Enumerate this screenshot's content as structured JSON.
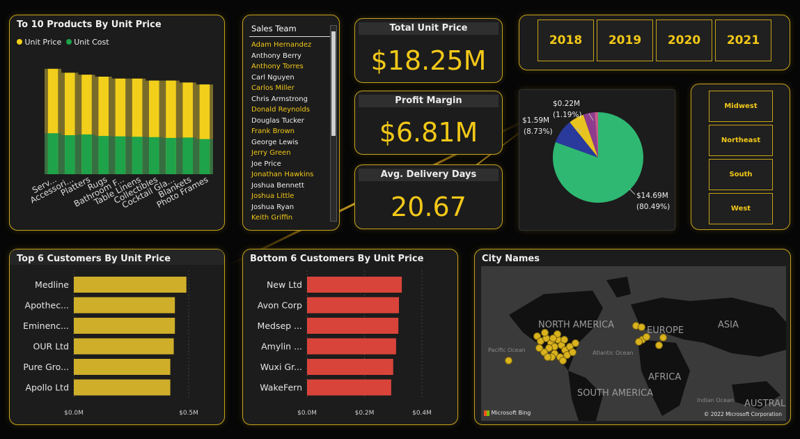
{
  "colors": {
    "accent_gold": "#f2c818",
    "unit_price": "#f2cf1a",
    "unit_cost": "#1fa34a",
    "customer_bar": "#cfae2a",
    "bottom_bar": "#d9443a",
    "pie_green": "#2eb872",
    "pie_navy": "#2a3a9c",
    "pie_yellow": "#e8c420",
    "pie_purple": "#8e3c8e"
  },
  "top_products": {
    "title": "To 10 Products By Unit Price",
    "legend": [
      {
        "label": "Unit Price",
        "color": "#f2cf1a"
      },
      {
        "label": "Unit Cost",
        "color": "#1fa34a"
      }
    ],
    "x_labels": [
      "Serv...",
      "Accessori...",
      "Platters",
      "Rugs",
      "Bathroom F...",
      "Table Linens",
      "Collectibles",
      "Cocktail Gla...",
      "Blankets",
      "Photo Frames"
    ]
  },
  "sales_team": {
    "header": "Sales Team",
    "items": [
      {
        "name": "Adam Hernandez",
        "selected": true
      },
      {
        "name": "Anthony Berry",
        "selected": false
      },
      {
        "name": "Anthony Torres",
        "selected": true
      },
      {
        "name": "Carl Nguyen",
        "selected": false
      },
      {
        "name": "Carlos Miller",
        "selected": true
      },
      {
        "name": "Chris Armstrong",
        "selected": false
      },
      {
        "name": "Donald Reynolds",
        "selected": true
      },
      {
        "name": "Douglas Tucker",
        "selected": false
      },
      {
        "name": "Frank Brown",
        "selected": true
      },
      {
        "name": "George Lewis",
        "selected": false
      },
      {
        "name": "Jerry Green",
        "selected": true
      },
      {
        "name": "Joe Price",
        "selected": false
      },
      {
        "name": "Jonathan Hawkins",
        "selected": true
      },
      {
        "name": "Joshua Bennett",
        "selected": false
      },
      {
        "name": "Joshua Little",
        "selected": true
      },
      {
        "name": "Joshua Ryan",
        "selected": false
      },
      {
        "name": "Keith Griffin",
        "selected": true
      }
    ]
  },
  "kpis": {
    "total_unit_price": {
      "label": "Total Unit Price",
      "value": "$18.25M"
    },
    "profit_margin": {
      "label": "Profit Margin",
      "value": "$6.81M"
    },
    "avg_delivery": {
      "label": "Avg. Delivery Days",
      "value": "20.67"
    }
  },
  "years": [
    "2018",
    "2019",
    "2020",
    "2021"
  ],
  "regions": [
    "Midwest",
    "Northeast",
    "South",
    "West"
  ],
  "pie": {
    "labels": {
      "small": {
        "value": "$0.22M",
        "pct": "(1.19%)"
      },
      "mid": {
        "value": "$1.59M",
        "pct": "(8.73%)"
      },
      "big": {
        "value": "$14.69M",
        "pct": "(80.49%)"
      }
    }
  },
  "top_customers": {
    "title": "Top 6 Customers By Unit Price",
    "ticks": [
      "$0.0M",
      "$0.5M"
    ]
  },
  "bottom_customers": {
    "title": "Bottom 6 Customers By Unit Price",
    "ticks": [
      "$0.0M",
      "$0.2M",
      "$0.4M"
    ]
  },
  "map": {
    "title": "City Names",
    "labels": [
      "NORTH AMERICA",
      "EUROPE",
      "ASIA",
      "AFRICA",
      "SOUTH AMERICA",
      "AUSTRALI",
      "Pacific Ocean",
      "Atlantic Ocean",
      "Indian Ocean"
    ],
    "brand": "Microsoft Bing",
    "copyright": "© 2022 Microsoft Corporation"
  },
  "chart_data": [
    {
      "type": "area",
      "title": "To 10 Products By Unit Price",
      "categories": [
        "Serv...",
        "Accessori...",
        "Platters",
        "Rugs",
        "Bathroom F...",
        "Table Linens",
        "Collectibles",
        "Cocktail Gla...",
        "Blankets",
        "Photo Frames"
      ],
      "series": [
        {
          "name": "Unit Price",
          "values": [
            2.7,
            2.6,
            2.55,
            2.5,
            2.45,
            2.45,
            2.4,
            2.4,
            2.35,
            2.3
          ]
        },
        {
          "name": "Unit Cost",
          "values": [
            1.05,
            1.0,
            1.02,
            0.98,
            0.97,
            0.96,
            0.95,
            0.93,
            0.94,
            0.9
          ]
        }
      ]
    },
    {
      "type": "pie",
      "slices": [
        {
          "value": 14.69,
          "pct": 80.49
        },
        {
          "value": 1.59,
          "pct": 8.73
        },
        {
          "value": 1.0,
          "pct": 5.48
        },
        {
          "value": 0.74,
          "pct": 4.11
        },
        {
          "value": 0.22,
          "pct": 1.19
        }
      ]
    },
    {
      "type": "bar",
      "title": "Top 6 Customers By Unit Price",
      "categories": [
        "Medline",
        "Apothec...",
        "Eminenc...",
        "OUR Ltd",
        "Pure Gro...",
        "Apollo Ltd"
      ],
      "values": [
        0.49,
        0.44,
        0.44,
        0.435,
        0.42,
        0.42
      ],
      "xlim": [
        0,
        0.5
      ]
    },
    {
      "type": "bar",
      "title": "Bottom 6 Customers By Unit Price",
      "categories": [
        "New Ltd",
        "Avon Corp",
        "Medsep ...",
        "Amylin ...",
        "Wuxi Gr...",
        "WakeFern"
      ],
      "values": [
        0.33,
        0.32,
        0.318,
        0.31,
        0.3,
        0.293
      ],
      "xlim": [
        0,
        0.4
      ]
    }
  ]
}
